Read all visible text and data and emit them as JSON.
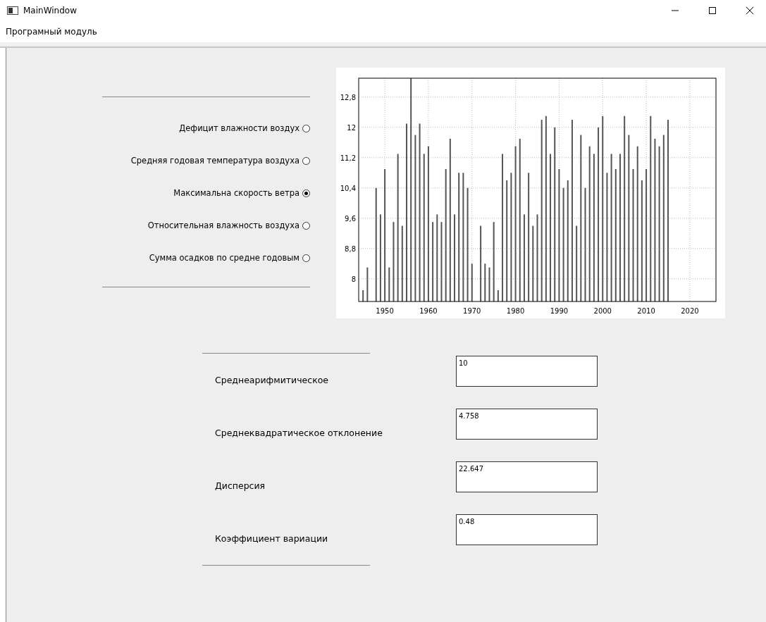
{
  "window": {
    "title": "MainWindow"
  },
  "menu": [
    "Програмный модуль"
  ],
  "options": [
    {
      "label": "Дефицит влажности воздух",
      "selected": false
    },
    {
      "label": "Средняя годовая температура воздуха",
      "selected": false
    },
    {
      "label": "Максимальна скорость ветра",
      "selected": true
    },
    {
      "label": "Относительная влажность воздуха",
      "selected": false
    },
    {
      "label": "Сумма осадков по средне годовым",
      "selected": false
    }
  ],
  "chart_data": {
    "type": "bar",
    "grid": true,
    "x": [
      1945,
      1946,
      1948,
      1949,
      1950,
      1951,
      1952,
      1953,
      1954,
      1955,
      1956,
      1957,
      1958,
      1959,
      1960,
      1961,
      1962,
      1963,
      1964,
      1965,
      1966,
      1967,
      1968,
      1969,
      1970,
      1972,
      1973,
      1974,
      1975,
      1976,
      1977,
      1978,
      1979,
      1980,
      1981,
      1982,
      1983,
      1984,
      1985,
      1986,
      1987,
      1988,
      1989,
      1990,
      1991,
      1992,
      1993,
      1994,
      1995,
      1996,
      1997,
      1998,
      1999,
      2000,
      2001,
      2002,
      2003,
      2004,
      2005,
      2006,
      2007,
      2008,
      2009,
      2010,
      2011,
      2012,
      2013,
      2014,
      2015
    ],
    "values": [
      7.7,
      8.3,
      10.4,
      9.7,
      10.9,
      8.3,
      9.5,
      11.3,
      9.4,
      12.1,
      13.3,
      11.8,
      12.1,
      11.3,
      11.5,
      9.5,
      9.7,
      9.5,
      10.9,
      11.7,
      9.7,
      10.8,
      10.8,
      10.4,
      8.4,
      9.4,
      8.4,
      8.3,
      9.5,
      7.7,
      11.3,
      10.6,
      10.8,
      11.5,
      11.7,
      9.7,
      10.8,
      9.4,
      9.7,
      12.2,
      12.3,
      11.3,
      12.0,
      10.9,
      10.4,
      10.6,
      12.2,
      9.4,
      11.8,
      10.4,
      11.5,
      11.3,
      12.0,
      12.3,
      10.8,
      11.3,
      10.9,
      11.3,
      12.3,
      11.8,
      10.9,
      11.5,
      10.6,
      10.9,
      12.3,
      11.7,
      11.5,
      11.8,
      12.2
    ],
    "xlim": [
      1944,
      2026
    ],
    "ylim": [
      7.4,
      13.3
    ],
    "xticks": [
      1950,
      1960,
      1970,
      1980,
      1990,
      2000,
      2010,
      2020
    ],
    "yticks": [
      {
        "value": 8,
        "label": "8"
      },
      {
        "value": 8.8,
        "label": "8,8"
      },
      {
        "value": 9.6,
        "label": "9,6"
      },
      {
        "value": 10.4,
        "label": "10,4"
      },
      {
        "value": 11.2,
        "label": "11,2"
      },
      {
        "value": 12,
        "label": "12"
      },
      {
        "value": 12.8,
        "label": "12,8"
      }
    ]
  },
  "statistics": [
    {
      "label": "Среднеарифмитическое",
      "value": "10"
    },
    {
      "label": "Среднеквадратическое отклонение",
      "value": "4.758"
    },
    {
      "label": "Дисперсия",
      "value": "22.647"
    },
    {
      "label": "Коэффициент вариации",
      "value": "0.48"
    }
  ]
}
